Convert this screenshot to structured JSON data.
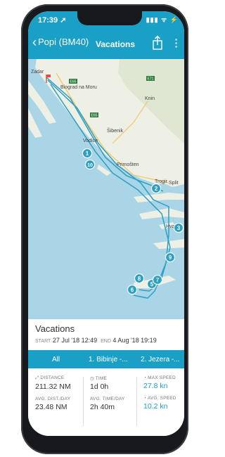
{
  "status": {
    "time": "17:39 ➚",
    "icons": "▮▮▮ ᯤ ⚡"
  },
  "nav": {
    "back_label": "Popi (BM40)",
    "title": "Vacations"
  },
  "map": {
    "places": [
      "Zadar",
      "Biograd na Moru",
      "Vodice",
      "Šibenik",
      "Primošten",
      "Trogir",
      "Split",
      "Hvar",
      "Knin"
    ],
    "road_labels": [
      "E65",
      "E65",
      "E71"
    ],
    "waypoints": [
      "1",
      "10",
      "2",
      "3",
      "9",
      "8",
      "5",
      "7",
      "6"
    ]
  },
  "trip": {
    "title": "Vacations",
    "start_label": "START",
    "start": "27 Jul '18 12:49",
    "end_label": "END",
    "end": "4 Aug '18 19:19"
  },
  "tabs": [
    {
      "label": "All",
      "active": true
    },
    {
      "label": "1. Bibinje -..."
    },
    {
      "label": "2. Jezera -..."
    }
  ],
  "stats": {
    "distance_label": "DISTANCE",
    "distance": "211.32 NM",
    "avg_dist_label": "AVG. DIST./DAY",
    "avg_dist": "23.48 NM",
    "time_label": "TIME",
    "time": "1d 0h",
    "avg_time_label": "AVG. TIME/DAY",
    "avg_time": "2h 40m",
    "max_speed_label": "MAX SPEED",
    "max_speed": "27.8 kn",
    "avg_speed_label": "AVG. SPEED",
    "avg_speed": "10.2 kn"
  },
  "colors": {
    "accent": "#1aa0c7",
    "sea": "#a9d5e6",
    "land": "#eef0e6",
    "route": "#2c9fc4"
  }
}
